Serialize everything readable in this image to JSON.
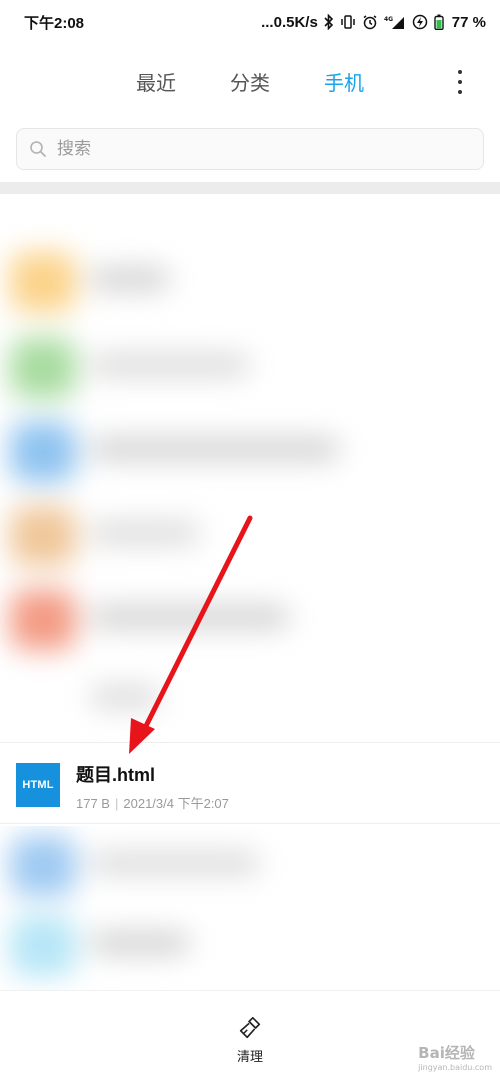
{
  "status_bar": {
    "time": "下午2:08",
    "network_speed": "...0.5K/s",
    "network_type": "4G",
    "battery_percent": "77 %"
  },
  "tabs": [
    {
      "label": "最近",
      "active": false
    },
    {
      "label": "分类",
      "active": false
    },
    {
      "label": "手机",
      "active": true
    }
  ],
  "search": {
    "placeholder": "搜索"
  },
  "file": {
    "icon_text": "HTML",
    "name": "题目.html",
    "size": "177 B",
    "separator": "|",
    "modified": "2021/3/4 下午2:07"
  },
  "bottom_bar": {
    "clean_label": "清理"
  },
  "watermark": {
    "brand": "Bai经验",
    "url": "jingyan.baidu.com"
  },
  "colors": {
    "accent": "#1aa3e8",
    "file_icon": "#1591de",
    "arrow": "#e8141b"
  }
}
